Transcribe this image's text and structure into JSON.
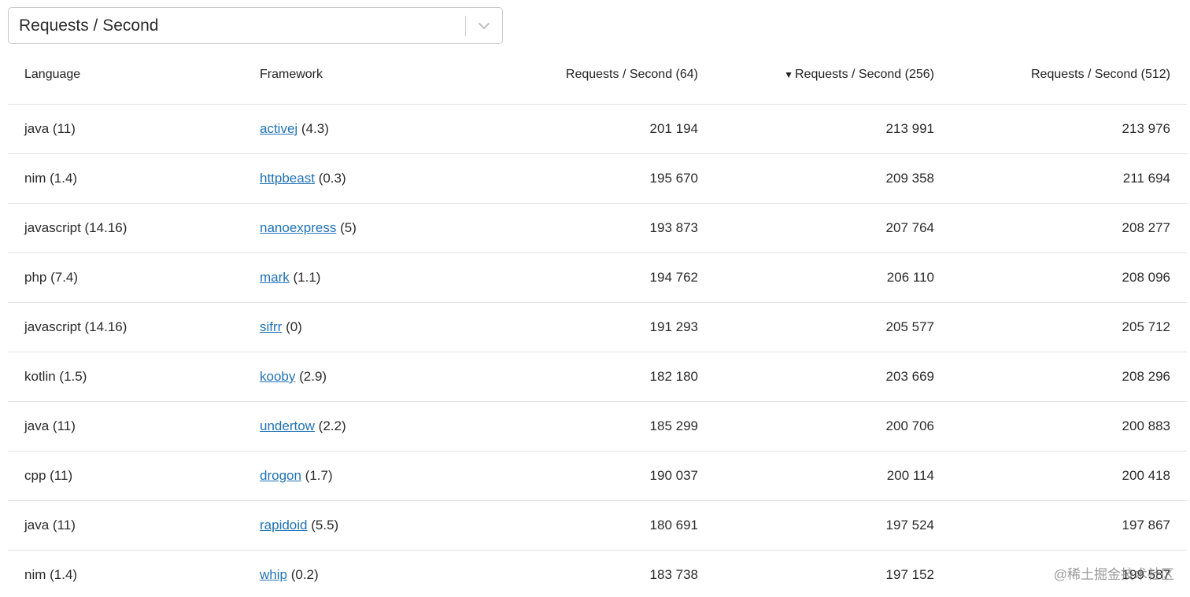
{
  "selector": {
    "value": "Requests / Second"
  },
  "table": {
    "headers": {
      "language": "Language",
      "framework": "Framework",
      "rps64": "Requests / Second (64)",
      "rps256": "Requests / Second (256)",
      "rps512": "Requests / Second (512)"
    },
    "sort_indicator": "▼",
    "rows": [
      {
        "language": "java (11)",
        "framework": "activej",
        "version": "(4.3)",
        "rps64": "201 194",
        "rps256": "213 991",
        "rps512": "213 976"
      },
      {
        "language": "nim (1.4)",
        "framework": "httpbeast",
        "version": "(0.3)",
        "rps64": "195 670",
        "rps256": "209 358",
        "rps512": "211 694"
      },
      {
        "language": "javascript (14.16)",
        "framework": "nanoexpress",
        "version": "(5)",
        "rps64": "193 873",
        "rps256": "207 764",
        "rps512": "208 277"
      },
      {
        "language": "php (7.4)",
        "framework": "mark",
        "version": "(1.1)",
        "rps64": "194 762",
        "rps256": "206 110",
        "rps512": "208 096"
      },
      {
        "language": "javascript (14.16)",
        "framework": "sifrr",
        "version": "(0)",
        "rps64": "191 293",
        "rps256": "205 577",
        "rps512": "205 712"
      },
      {
        "language": "kotlin (1.5)",
        "framework": "kooby",
        "version": "(2.9)",
        "rps64": "182 180",
        "rps256": "203 669",
        "rps512": "208 296"
      },
      {
        "language": "java (11)",
        "framework": "undertow",
        "version": "(2.2)",
        "rps64": "185 299",
        "rps256": "200 706",
        "rps512": "200 883"
      },
      {
        "language": "cpp (11)",
        "framework": "drogon",
        "version": "(1.7)",
        "rps64": "190 037",
        "rps256": "200 114",
        "rps512": "200 418"
      },
      {
        "language": "java (11)",
        "framework": "rapidoid",
        "version": "(5.5)",
        "rps64": "180 691",
        "rps256": "197 524",
        "rps512": "197 867"
      },
      {
        "language": "nim (1.4)",
        "framework": "whip",
        "version": "(0.2)",
        "rps64": "183 738",
        "rps256": "197 152",
        "rps512": "199 587"
      }
    ]
  },
  "watermark": "@稀土掘金技术社区",
  "colors": {
    "link": "#2173b8",
    "border": "#e2e2e2"
  },
  "icons": {
    "select_chevron": "chevron-down-icon"
  }
}
